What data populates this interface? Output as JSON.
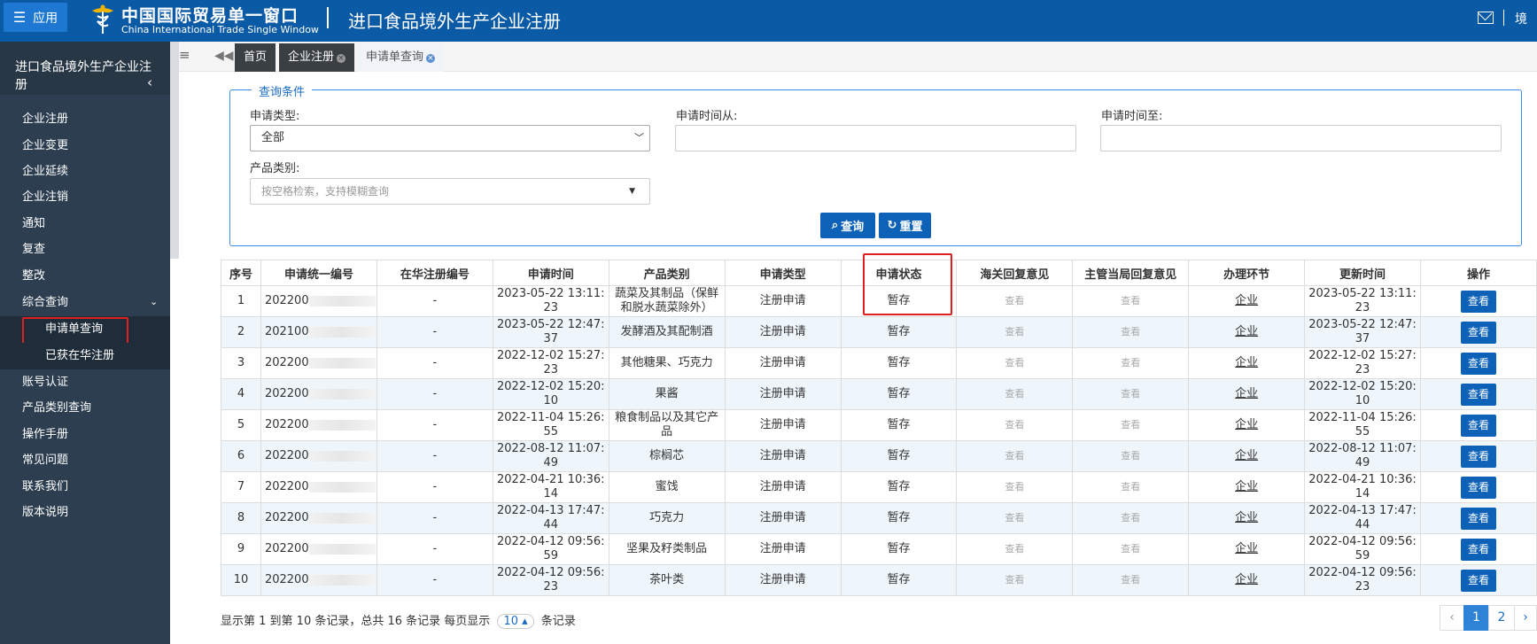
{
  "header": {
    "app_label": "应用",
    "brand_cn": "中国国际贸易单一窗口",
    "brand_en": "China International Trade Single Window",
    "system_title": "进口食品境外生产企业注册",
    "user_truncated": "境"
  },
  "sidebar": {
    "title": "进口食品境外生产企业注册",
    "items": [
      "企业注册",
      "企业变更",
      "企业延续",
      "企业注销",
      "通知",
      "复查",
      "整改",
      "综合查询"
    ],
    "sub_items": [
      "申请单查询",
      "已获在华注册"
    ],
    "items_after": [
      "账号认证",
      "产品类别查询",
      "操作手册",
      "常见问题",
      "联系我们",
      "版本说明"
    ]
  },
  "tabs": [
    {
      "label": "首页"
    },
    {
      "label": "企业注册"
    },
    {
      "label": "申请单查询"
    }
  ],
  "filters": {
    "legend": "查询条件",
    "app_type_label": "申请类型:",
    "app_type_value": "全部",
    "time_from_label": "申请时间从:",
    "time_to_label": "申请时间至:",
    "product_cat_label": "产品类别:",
    "product_cat_placeholder": "按空格检索，支持模糊查询",
    "search_btn": "查询",
    "reset_btn": "重置"
  },
  "table": {
    "headers": [
      "序号",
      "申请统一编号",
      "在华注册编号",
      "申请时间",
      "产品类别",
      "申请类型",
      "申请状态",
      "海关回复意见",
      "主管当局回复意见",
      "办理环节",
      "更新时间",
      "操作"
    ],
    "rows": [
      {
        "idx": "1",
        "id": "202200",
        "reg": "-",
        "time": "2023-05-22 13:11:23",
        "cat": "蔬菜及其制品（保鲜和脱水蔬菜除外）",
        "type": "注册申请",
        "status": "暂存",
        "customs": "查看",
        "authority": "查看",
        "stage": "企业",
        "updated": "2023-05-22 13:11:23",
        "op": "查看"
      },
      {
        "idx": "2",
        "id": "202100",
        "reg": "-",
        "time": "2023-05-22 12:47:37",
        "cat": "发酵酒及其配制酒",
        "type": "注册申请",
        "status": "暂存",
        "customs": "查看",
        "authority": "查看",
        "stage": "企业",
        "updated": "2023-05-22 12:47:37",
        "op": "查看"
      },
      {
        "idx": "3",
        "id": "202200",
        "reg": "-",
        "time": "2022-12-02 15:27:23",
        "cat": "其他糖果、巧克力",
        "type": "注册申请",
        "status": "暂存",
        "customs": "查看",
        "authority": "查看",
        "stage": "企业",
        "updated": "2022-12-02 15:27:23",
        "op": "查看"
      },
      {
        "idx": "4",
        "id": "202200",
        "reg": "-",
        "time": "2022-12-02 15:20:10",
        "cat": "果酱",
        "type": "注册申请",
        "status": "暂存",
        "customs": "查看",
        "authority": "查看",
        "stage": "企业",
        "updated": "2022-12-02 15:20:10",
        "op": "查看"
      },
      {
        "idx": "5",
        "id": "202200",
        "reg": "-",
        "time": "2022-11-04 15:26:55",
        "cat": "粮食制品以及其它产品",
        "type": "注册申请",
        "status": "暂存",
        "customs": "查看",
        "authority": "查看",
        "stage": "企业",
        "updated": "2022-11-04 15:26:55",
        "op": "查看"
      },
      {
        "idx": "6",
        "id": "202200",
        "reg": "-",
        "time": "2022-08-12 11:07:49",
        "cat": "棕榈芯",
        "type": "注册申请",
        "status": "暂存",
        "customs": "查看",
        "authority": "查看",
        "stage": "企业",
        "updated": "2022-08-12 11:07:49",
        "op": "查看"
      },
      {
        "idx": "7",
        "id": "202200",
        "reg": "-",
        "time": "2022-04-21 10:36:14",
        "cat": "蜜饯",
        "type": "注册申请",
        "status": "暂存",
        "customs": "查看",
        "authority": "查看",
        "stage": "企业",
        "updated": "2022-04-21 10:36:14",
        "op": "查看"
      },
      {
        "idx": "8",
        "id": "202200",
        "reg": "-",
        "time": "2022-04-13 17:47:44",
        "cat": "巧克力",
        "type": "注册申请",
        "status": "暂存",
        "customs": "查看",
        "authority": "查看",
        "stage": "企业",
        "updated": "2022-04-13 17:47:44",
        "op": "查看"
      },
      {
        "idx": "9",
        "id": "202200",
        "reg": "-",
        "time": "2022-04-12 09:56:59",
        "cat": "坚果及籽类制品",
        "type": "注册申请",
        "status": "暂存",
        "customs": "查看",
        "authority": "查看",
        "stage": "企业",
        "updated": "2022-04-12 09:56:59",
        "op": "查看"
      },
      {
        "idx": "10",
        "id": "202200",
        "reg": "-",
        "time": "2022-04-12 09:56:23",
        "cat": "茶叶类",
        "type": "注册申请",
        "status": "暂存",
        "customs": "查看",
        "authority": "查看",
        "stage": "企业",
        "updated": "2022-04-12 09:56:23",
        "op": "查看"
      }
    ]
  },
  "footer": {
    "info_prefix": "显示第 1 到第 10 条记录，总共 16 条记录  每页显示",
    "page_size": "10",
    "info_suffix": "条记录",
    "prev": "‹",
    "pages": [
      "1",
      "2"
    ],
    "next": "›"
  },
  "colors": {
    "header_bg": "#0a5aa6",
    "sidebar_bg": "#2c3e50",
    "primary": "#0d62b8",
    "highlight": "#e02020"
  }
}
